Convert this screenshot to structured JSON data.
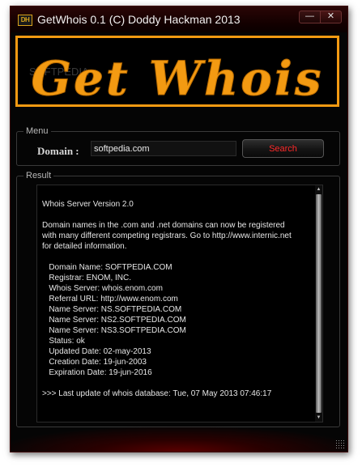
{
  "window": {
    "icon_text": "DH",
    "title": "GetWhois 0.1 (C) Doddy Hackman 2013",
    "minimize_symbol": "—",
    "close_symbol": "✕"
  },
  "banner": {
    "text": "Get Whois",
    "watermark": "SOFTPEDIA",
    "color": "#f39a12"
  },
  "menu": {
    "group_label": "Menu",
    "domain_label": "Domain :",
    "domain_value": "softpedia.com",
    "search_label": "Search"
  },
  "result": {
    "group_label": "Result",
    "text": "\nWhois Server Version 2.0\n\nDomain names in the .com and .net domains can now be registered\nwith many different competing registrars. Go to http://www.internic.net\nfor detailed information.\n\n   Domain Name: SOFTPEDIA.COM\n   Registrar: ENOM, INC.\n   Whois Server: whois.enom.com\n   Referral URL: http://www.enom.com\n   Name Server: NS.SOFTPEDIA.COM\n   Name Server: NS2.SOFTPEDIA.COM\n   Name Server: NS3.SOFTPEDIA.COM\n   Status: ok\n   Updated Date: 02-may-2013\n   Creation Date: 19-jun-2003\n   Expiration Date: 19-jun-2016\n\n>>> Last update of whois database: Tue, 07 May 2013 07:46:17"
  },
  "colors": {
    "accent": "#f39a12",
    "search_text": "#ff2a2a",
    "background": "#050505"
  }
}
